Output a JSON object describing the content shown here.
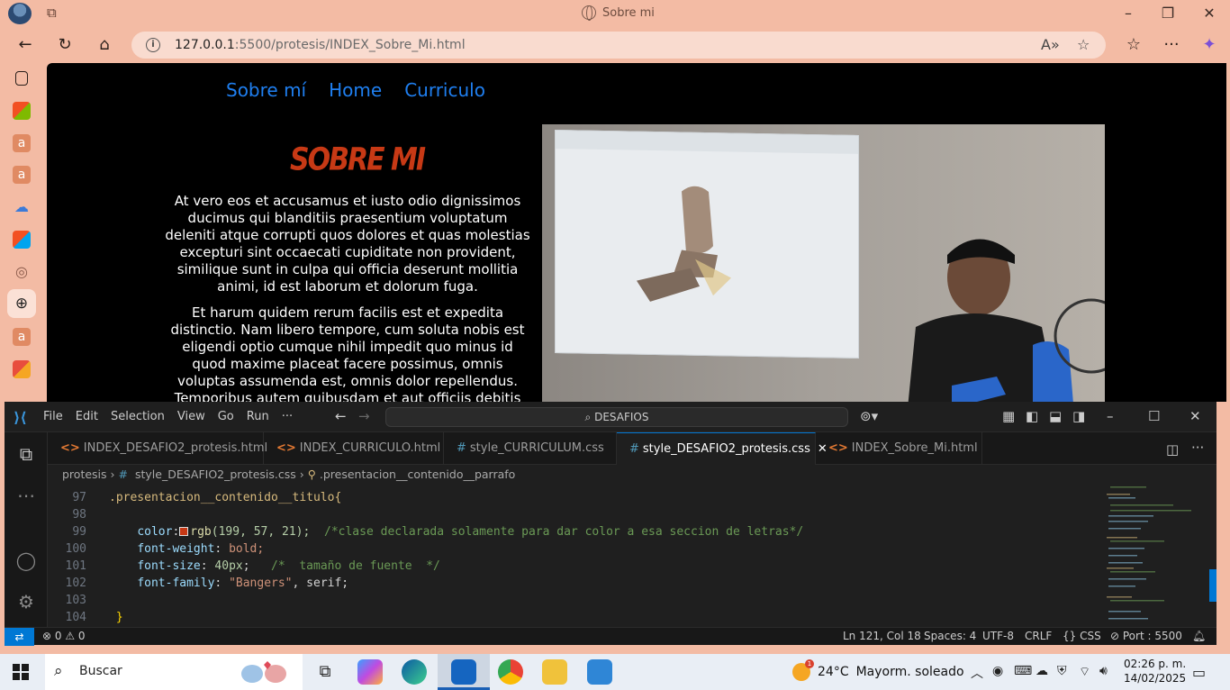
{
  "browser": {
    "window_title": "Sobre mi",
    "url_host": "127.0.0.1",
    "url_rest": ":5500/protesis/INDEX_Sobre_Mi.html"
  },
  "site": {
    "nav": [
      "Sobre mí",
      "Home",
      "Curriculo"
    ],
    "title": "SOBRE MI",
    "paragraph1": "At vero eos et accusamus et iusto odio dignissimos ducimus qui blanditiis praesentium voluptatum deleniti atque corrupti quos dolores et quas molestias excepturi sint occaecati cupiditate non provident, similique sunt in culpa qui officia deserunt mollitia animi, id est laborum et dolorum fuga.",
    "paragraph2": "Et harum quidem rerum facilis est et expedita distinctio. Nam libero tempore, cum soluta nobis est eligendi optio cumque nihil impedit quo minus id quod maxime placeat facere possimus, omnis voluptas assumenda est, omnis dolor repellendus. Temporibus autem quibusdam et aut officiis debitis"
  },
  "vscode": {
    "menu": [
      "File",
      "Edit",
      "Selection",
      "View",
      "Go",
      "Run",
      "···"
    ],
    "search": "DESAFIOS",
    "tabs": [
      {
        "label": "INDEX_DESAFIO2_protesis.html",
        "kind": "html"
      },
      {
        "label": "INDEX_CURRICULO.html",
        "kind": "html"
      },
      {
        "label": "style_CURRICULUM.css",
        "kind": "css"
      },
      {
        "label": "style_DESAFIO2_protesis.css",
        "kind": "css"
      },
      {
        "label": "INDEX_Sobre_Mi.html",
        "kind": "html"
      }
    ],
    "breadcrumb": {
      "folder": "protesis",
      "file": "style_DESAFIO2_protesis.css",
      "symbol": ".presentacion__contenido__parrafo"
    },
    "lines": {
      "n97": "97",
      "n98": "98",
      "n99": "99",
      "n100": "100",
      "n101": "101",
      "n102": "102",
      "n103": "103",
      "n104": "104",
      "l97": ".presentacion__contenido__titulo{",
      "l99_prop": "color",
      "l99_fn": "rgb",
      "l99_args": "(199, 57, 21);",
      "l99_comment": "/*clase declarada solamente para dar color a esa seccion de letras*/",
      "l100_prop": "font-weight",
      "l100_val": "bold;",
      "l101_prop": "font-size",
      "l101_val": "40px",
      "l101_comment": "/*  tamaño de fuente  */",
      "l102_prop": "font-family",
      "l102_val": "\"Bangers\"",
      "l102_rest": ", serif;",
      "l104": "}"
    },
    "status": {
      "errors": "0",
      "warnings": "0",
      "position": "Ln 121, Col 18",
      "spaces": "Spaces: 4",
      "encoding": "UTF-8",
      "eol": "CRLF",
      "language": "CSS",
      "port": "Port : 5500"
    }
  },
  "taskbar": {
    "search_placeholder": "Buscar",
    "weather_temp": "24°C",
    "weather_desc": "Mayorm. soleado",
    "weather_badge": "1",
    "time": "02:26 p. m.",
    "date": "14/02/2025"
  }
}
